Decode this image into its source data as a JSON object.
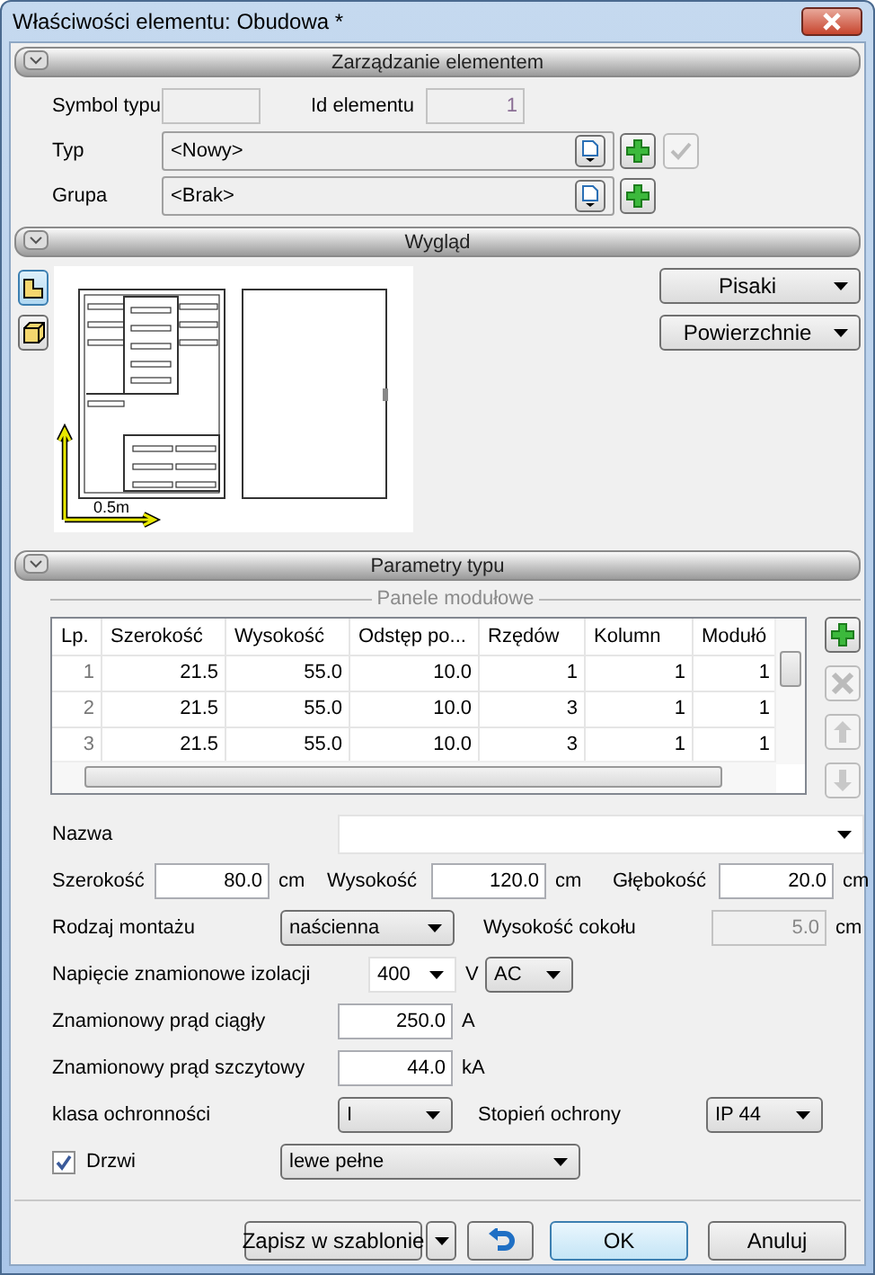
{
  "window": {
    "title": "Właściwości elementu: Obudowa *"
  },
  "management": {
    "header": "Zarządzanie elementem",
    "symbol": {
      "label": "Symbol typu",
      "disabled": true
    },
    "id": {
      "label": "Id elementu",
      "value": "1",
      "disabled": true
    },
    "type": {
      "label": "Typ",
      "value": "<Nowy>",
      "confirm_disabled": true
    },
    "group": {
      "label": "Grupa",
      "value": "<Brak>"
    }
  },
  "appearance": {
    "header": "Wygląd",
    "view_buttons": [
      {
        "kind": "plan",
        "selected": true
      },
      {
        "kind": "solid",
        "selected": false
      }
    ],
    "scale_label": "0.5m",
    "menus": [
      "Pisaki",
      "Powierzchnie"
    ]
  },
  "parameters": {
    "header": "Parametry typu",
    "group_title": "Panele modułowe",
    "table": {
      "columns": [
        "Lp.",
        "Szerokość",
        "Wysokość",
        "Odstęp po...",
        "Rzędów",
        "Kolumn",
        "Modułó"
      ],
      "rows": [
        [
          "1",
          "21.5",
          "55.0",
          "10.0",
          "1",
          "1",
          "1"
        ],
        [
          "2",
          "21.5",
          "55.0",
          "10.0",
          "3",
          "1",
          "1"
        ],
        [
          "3",
          "21.5",
          "55.0",
          "10.0",
          "3",
          "1",
          "1"
        ]
      ]
    },
    "table_buttons": [
      {
        "kind": "add",
        "disabled": false
      },
      {
        "kind": "delete",
        "disabled": true
      },
      {
        "kind": "up",
        "disabled": true
      },
      {
        "kind": "down",
        "disabled": true
      }
    ]
  },
  "form": {
    "name": {
      "label": "Nazwa"
    },
    "width": {
      "label": "Szerokość",
      "value": "80.0",
      "unit": "cm"
    },
    "height": {
      "label": "Wysokość",
      "value": "120.0",
      "unit": "cm"
    },
    "depth": {
      "label": "Głębokość",
      "value": "20.0",
      "unit": "cm"
    },
    "mounting": {
      "label": "Rodzaj montażu",
      "value": "naścienna"
    },
    "plinth": {
      "label": "Wysokość cokołu",
      "value": "5.0",
      "unit": "cm",
      "disabled": true
    },
    "voltage": {
      "label": "Napięcie znamionowe izolacji",
      "value": "400",
      "unit": "V",
      "current_type": "AC"
    },
    "continuous": {
      "label": "Znamionowy prąd ciągły",
      "value": "250.0",
      "unit": "A"
    },
    "peak": {
      "label": "Znamionowy prąd szczytowy",
      "value": "44.0",
      "unit": "kA"
    },
    "protection_class": {
      "label": "klasa ochronności",
      "value": "I"
    },
    "ip": {
      "label": "Stopień ochrony",
      "value": "IP 44"
    },
    "door": {
      "label": "Drzwi",
      "checked": true,
      "value": "lewe pełne"
    }
  },
  "buttons": {
    "save_template": "Zapisz w szablonie",
    "ok": "OK",
    "cancel": "Anuluj"
  }
}
